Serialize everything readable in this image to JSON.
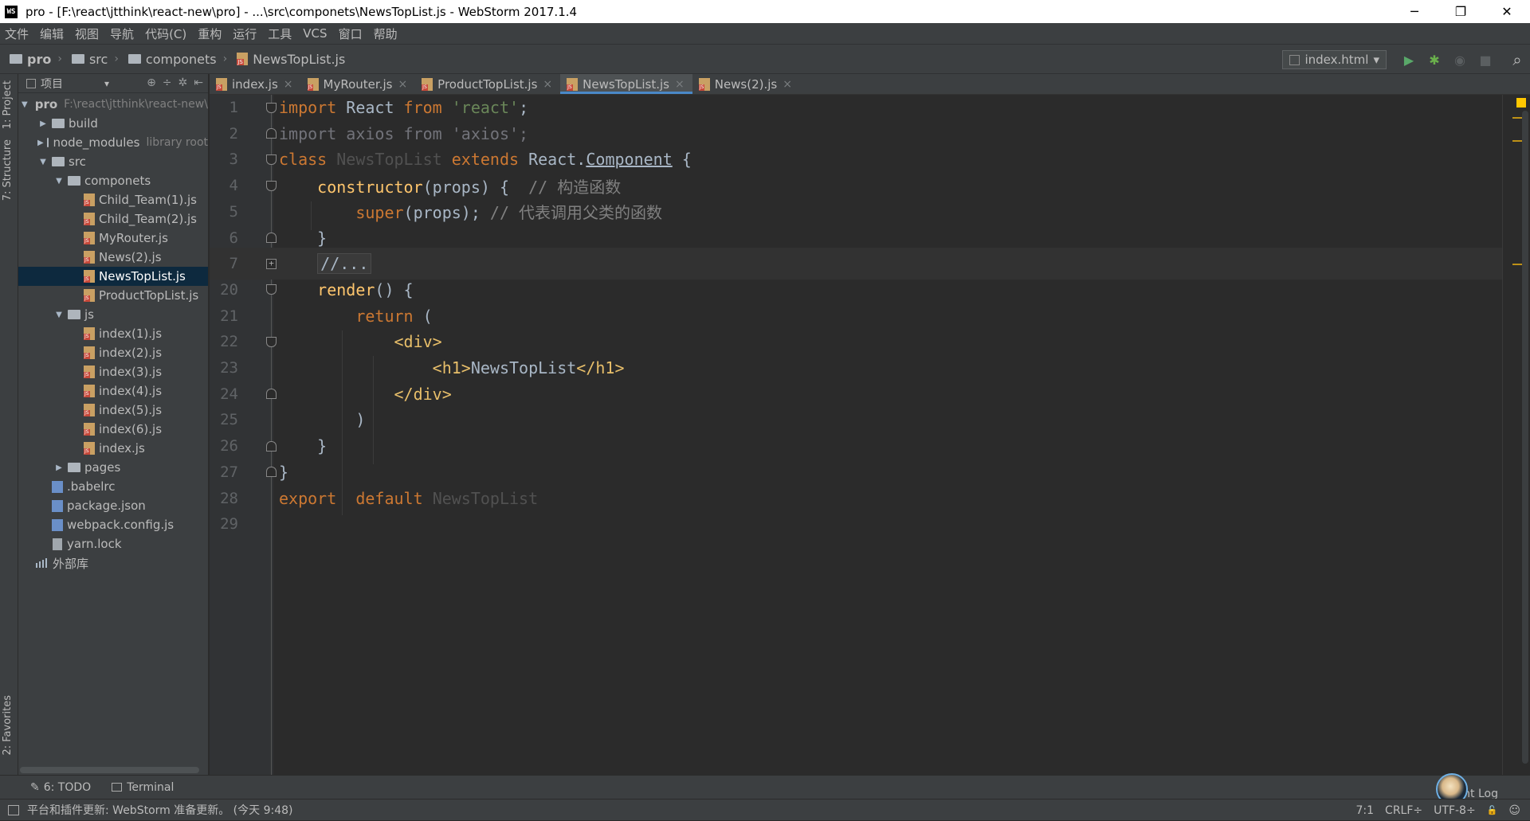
{
  "window": {
    "logo": "WS",
    "title": "pro - [F:\\react\\jtthink\\react-new\\pro] - ...\\src\\componets\\NewsTopList.js - WebStorm 2017.1.4",
    "minimize": "─",
    "restore": "❐",
    "close": "✕"
  },
  "menu": [
    "文件",
    "编辑",
    "视图",
    "导航",
    "代码(C)",
    "重构",
    "运行",
    "工具",
    "VCS",
    "窗口",
    "帮助"
  ],
  "breadcrumb": [
    "pro",
    "src",
    "componets",
    "NewsTopList.js"
  ],
  "run_config": {
    "label": "index.html",
    "arrow": "▾"
  },
  "toolbar_icons": {
    "run": "▶",
    "debug": "✱",
    "coverage": "◉",
    "stop": "■",
    "search": "⌕"
  },
  "left_strip": {
    "project": "1: Project",
    "structure": "7: Structure",
    "favorites": "2: Favorites"
  },
  "project_panel": {
    "header": "项目",
    "header_arrow": "▾",
    "tools": [
      "⊕",
      "÷",
      "✲",
      "⇤"
    ],
    "tree": [
      {
        "label": "pro",
        "hint": "F:\\react\\jtthink\\react-new\\pro",
        "icon": "folder",
        "level": 0,
        "arrow": "▼",
        "bold": true
      },
      {
        "label": "build",
        "icon": "folder",
        "level": 1,
        "arrow": "▶"
      },
      {
        "label": "node_modules",
        "hint": "library root",
        "icon": "folder",
        "level": 1,
        "arrow": "▶"
      },
      {
        "label": "src",
        "icon": "folder",
        "level": 1,
        "arrow": "▼"
      },
      {
        "label": "componets",
        "icon": "folder",
        "level": 2,
        "arrow": "▼"
      },
      {
        "label": "Child_Team(1).js",
        "icon": "js",
        "level": 3
      },
      {
        "label": "Child_Team(2).js",
        "icon": "js",
        "level": 3
      },
      {
        "label": "MyRouter.js",
        "icon": "js",
        "level": 3
      },
      {
        "label": "News(2).js",
        "icon": "js",
        "level": 3
      },
      {
        "label": "NewsTopList.js",
        "icon": "js",
        "level": 3,
        "selected": true
      },
      {
        "label": "ProductTopList.js",
        "icon": "js",
        "level": 3
      },
      {
        "label": "js",
        "icon": "folder",
        "level": 2,
        "arrow": "▼"
      },
      {
        "label": "index(1).js",
        "icon": "js",
        "level": 3
      },
      {
        "label": "index(2).js",
        "icon": "js",
        "level": 3
      },
      {
        "label": "index(3).js",
        "icon": "js",
        "level": 3
      },
      {
        "label": "index(4).js",
        "icon": "js",
        "level": 3
      },
      {
        "label": "index(5).js",
        "icon": "js",
        "level": 3
      },
      {
        "label": "index(6).js",
        "icon": "js",
        "level": 3
      },
      {
        "label": "index.js",
        "icon": "js",
        "level": 3
      },
      {
        "label": "pages",
        "icon": "folder",
        "level": 2,
        "arrow": "▶"
      },
      {
        "label": ".babelrc",
        "icon": "json",
        "level": 1
      },
      {
        "label": "package.json",
        "icon": "json",
        "level": 1
      },
      {
        "label": "webpack.config.js",
        "icon": "json",
        "level": 1
      },
      {
        "label": "yarn.lock",
        "icon": "file",
        "level": 1
      },
      {
        "label": "外部库",
        "icon": "lib",
        "level": 0
      }
    ]
  },
  "editor_tabs": [
    {
      "label": "index.js",
      "active": false
    },
    {
      "label": "MyRouter.js",
      "active": false
    },
    {
      "label": "ProductTopList.js",
      "active": false
    },
    {
      "label": "NewsTopList.js",
      "active": true
    },
    {
      "label": "News(2).js",
      "active": false
    }
  ],
  "tab_close": "×",
  "code_lines": [
    {
      "num": "1",
      "fold": "open",
      "html": "<span class=\"kw\">import</span> React <span class=\"kw\">from</span> <span class=\"str\">'react'</span>;"
    },
    {
      "num": "2",
      "fold": "end",
      "html": "<span class=\"unused\">import axios from 'axios';</span>"
    },
    {
      "num": "3",
      "fold": "open",
      "html": "<span class=\"kw\">class</span> <span class=\"dim\">NewsTopList</span> <span class=\"kw\">extends</span> React.<u>Component</u> {"
    },
    {
      "num": "4",
      "fold": "open",
      "html": "    <span class=\"fn\">constructor</span>(props) {  <span class=\"cmt\">// 构造函数</span>"
    },
    {
      "num": "5",
      "fold": "",
      "html": "        <span class=\"kw\">super</span>(props); <span class=\"cmt\">// 代表调用父类的函数</span>"
    },
    {
      "num": "6",
      "fold": "end",
      "html": "    }"
    },
    {
      "num": "7",
      "fold": "plus",
      "current": true,
      "html": "    <span class=\"collapsed\">//...</span>"
    },
    {
      "num": "20",
      "fold": "open",
      "html": "    <span class=\"fn\">render</span>() {"
    },
    {
      "num": "21",
      "fold": "",
      "html": "        <span class=\"kw\">return</span> ("
    },
    {
      "num": "22",
      "fold": "open",
      "html": "            <span class=\"tag\">&lt;div&gt;</span>"
    },
    {
      "num": "23",
      "fold": "",
      "html": "                <span class=\"tag\">&lt;h1&gt;</span>NewsTopList<span class=\"tag\">&lt;/h1&gt;</span>"
    },
    {
      "num": "24",
      "fold": "end",
      "html": "            <span class=\"tag\">&lt;/div&gt;</span>"
    },
    {
      "num": "25",
      "fold": "",
      "html": "        )"
    },
    {
      "num": "26",
      "fold": "end",
      "html": "    }"
    },
    {
      "num": "27",
      "fold": "end",
      "html": "}"
    },
    {
      "num": "28",
      "fold": "",
      "html": "<span class=\"kw\">export</span>  <span class=\"kw\">default</span> <span class=\"dim\">NewsTopList</span>"
    },
    {
      "num": "29",
      "fold": "",
      "html": ""
    }
  ],
  "bottom_tools": {
    "todo": "6: TODO",
    "terminal": "Terminal",
    "event_log": "nt Log"
  },
  "status": {
    "message": "平台和插件更新: WebStorm 准备更新。 (今天 9:48)",
    "position": "7:1",
    "line_sep": "CRLF÷",
    "encoding": "UTF-8÷",
    "lock": "🔓",
    "inspector": "☺"
  }
}
